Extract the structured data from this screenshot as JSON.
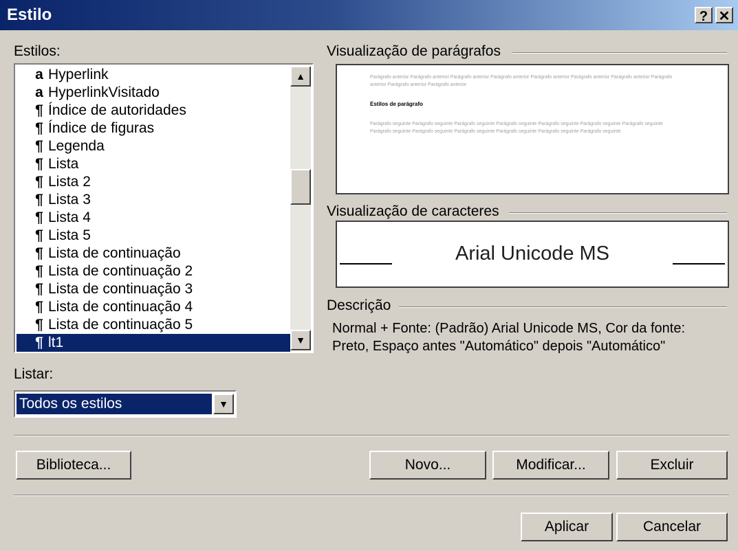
{
  "window": {
    "title": "Estilo",
    "help_label": "?",
    "close_label": "✕"
  },
  "styles": {
    "label": "Estilos:",
    "items": [
      {
        "glyph": "a",
        "label": "Hyperlink"
      },
      {
        "glyph": "a",
        "label": "HyperlinkVisitado"
      },
      {
        "glyph": "¶",
        "label": "Índice de autoridades"
      },
      {
        "glyph": "¶",
        "label": "Índice de figuras"
      },
      {
        "glyph": "¶",
        "label": "Legenda"
      },
      {
        "glyph": "¶",
        "label": "Lista"
      },
      {
        "glyph": "¶",
        "label": "Lista 2"
      },
      {
        "glyph": "¶",
        "label": "Lista 3"
      },
      {
        "glyph": "¶",
        "label": "Lista 4"
      },
      {
        "glyph": "¶",
        "label": "Lista 5"
      },
      {
        "glyph": "¶",
        "label": "Lista de continuação"
      },
      {
        "glyph": "¶",
        "label": "Lista de continuação 2"
      },
      {
        "glyph": "¶",
        "label": "Lista de continuação 3"
      },
      {
        "glyph": "¶",
        "label": "Lista de continuação 4"
      },
      {
        "glyph": "¶",
        "label": "Lista de continuação 5"
      },
      {
        "glyph": "¶",
        "label": "lt1"
      }
    ],
    "selected": "lt1",
    "scroll_up": "▲",
    "scroll_down": "▼"
  },
  "list_filter": {
    "label": "Listar:",
    "value": "Todos os estilos",
    "arrow": "▼"
  },
  "paragraph_preview": {
    "label": "Visualização de parágrafos",
    "prev_text": "Parágrafo anterior Parágrafo anterior Parágrafo anterior Parágrafo anterior Parágrafo anterior Parágrafo anterior Parágrafo anterior Parágrafo anterior Parágrafo anterior Parágrafo anterior",
    "sample_title": "Estilos de parágrafo",
    "next_text": "Parágrafo seguinte Parágrafo seguinte Parágrafo seguinte Parágrafo seguinte Parágrafo seguinte Parágrafo seguinte Parágrafo seguinte Parágrafo seguinte Parágrafo seguinte Parágrafo seguinte Parágrafo seguinte Parágrafo seguinte Parágrafo seguinte"
  },
  "character_preview": {
    "label": "Visualização de caracteres",
    "sample": "Arial Unicode MS"
  },
  "description": {
    "label": "Descrição",
    "text": "Normal + Fonte: (Padrão) Arial Unicode MS, Cor da fonte: Preto, Espaço antes \"Automático\" depois \"Automático\""
  },
  "buttons": {
    "library": "Biblioteca...",
    "new": "Novo...",
    "modify": "Modificar...",
    "delete": "Excluir",
    "apply": "Aplicar",
    "cancel": "Cancelar"
  }
}
